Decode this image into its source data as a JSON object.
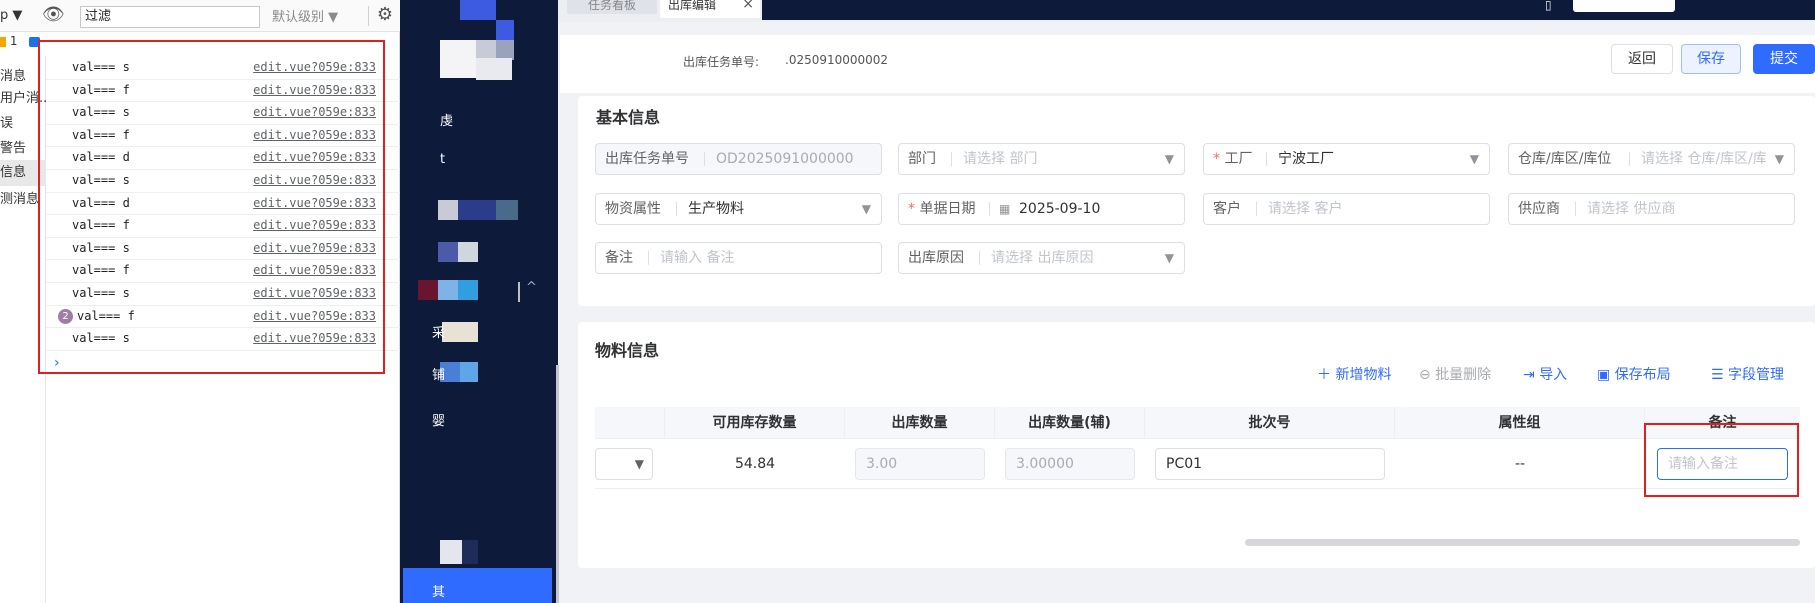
{
  "devtools": {
    "context": "p ▼",
    "filter_value": "过滤",
    "level_label": "默认级别 ▼",
    "counts": {
      "warnings": "1"
    },
    "sidebar": [
      {
        "label": "消息"
      },
      {
        "label": "用户消..."
      },
      {
        "label": "误"
      },
      {
        "label": "警告"
      },
      {
        "label": "信息",
        "active": true
      },
      {
        "label": "测消息"
      }
    ],
    "logs": [
      {
        "msg": "val=== s",
        "src": "edit.vue?059e:833"
      },
      {
        "msg": "val=== f",
        "src": "edit.vue?059e:833"
      },
      {
        "msg": "val=== s",
        "src": "edit.vue?059e:833"
      },
      {
        "msg": "val=== f",
        "src": "edit.vue?059e:833"
      },
      {
        "msg": "val=== d",
        "src": "edit.vue?059e:833"
      },
      {
        "msg": "val=== s",
        "src": "edit.vue?059e:833"
      },
      {
        "msg": "val=== d",
        "src": "edit.vue?059e:833"
      },
      {
        "msg": "val=== f",
        "src": "edit.vue?059e:833"
      },
      {
        "msg": "val=== s",
        "src": "edit.vue?059e:833"
      },
      {
        "msg": "val=== f",
        "src": "edit.vue?059e:833"
      },
      {
        "msg": "val=== s",
        "src": "edit.vue?059e:833"
      },
      {
        "msg": "val=== f",
        "src": "edit.vue?059e:833",
        "count": "2"
      },
      {
        "msg": "val=== s",
        "src": "edit.vue?059e:833"
      }
    ],
    "prompt": "›"
  },
  "nav": {
    "labels": [
      "虔",
      "t",
      "采",
      "铺",
      "婴",
      "其"
    ],
    "collapse_icon": "^"
  },
  "tabs": {
    "inactive_label": "任务看板",
    "active_label": "出库编辑",
    "close": "×"
  },
  "header": {
    "task_no_label": "出库任务单号:",
    "task_no_value": ".0250910000002",
    "back": "返回",
    "save": "保存",
    "submit": "提交"
  },
  "basic": {
    "title": "基本信息",
    "fields": [
      {
        "label": "出库任务单号",
        "value": "OD20250910000002",
        "placeholder": false,
        "disabled": true,
        "required": false,
        "caret": false
      },
      {
        "label": "部门",
        "value": "请选择 部门",
        "placeholder": true,
        "disabled": false,
        "required": false,
        "caret": true
      },
      {
        "label": "工厂",
        "value": "宁波工厂",
        "placeholder": false,
        "disabled": false,
        "required": true,
        "caret": true
      },
      {
        "label": "仓库/库区/库位",
        "value": "请选择 仓库/库区/库",
        "placeholder": true,
        "disabled": false,
        "required": false,
        "caret": true
      },
      {
        "label": "物资属性",
        "value": "生产物料",
        "placeholder": false,
        "disabled": false,
        "required": false,
        "caret": true
      },
      {
        "label": "单据日期",
        "value": "2025-09-10",
        "placeholder": false,
        "disabled": false,
        "required": true,
        "caret": false,
        "icon": "calendar-icon"
      },
      {
        "label": "客户",
        "value": "请选择 客户",
        "placeholder": true,
        "disabled": false,
        "required": false,
        "caret": false
      },
      {
        "label": "供应商",
        "value": "请选择 供应商",
        "placeholder": true,
        "disabled": false,
        "required": false,
        "caret": false
      },
      {
        "label": "备注",
        "value": "请输入 备注",
        "placeholder": true,
        "disabled": false,
        "required": false,
        "caret": false
      },
      {
        "label": "出库原因",
        "value": "请选择 出库原因",
        "placeholder": true,
        "disabled": false,
        "required": false,
        "caret": true
      }
    ]
  },
  "material": {
    "title": "物料信息",
    "toolbar": {
      "add": "新增物料",
      "batch_delete": "批量删除",
      "import": "导入",
      "save_layout": "保存布局",
      "field_manage": "字段管理"
    },
    "columns": [
      "可用库存数量",
      "出库数量",
      "出库数量(辅)",
      "批次号",
      "属性组",
      "备注"
    ],
    "row": {
      "available": "54.84",
      "qty": "3.00",
      "qty_aux": "3.00000",
      "batch": "PC01",
      "attr_group": "--",
      "remark_placeholder": "请输入备注"
    }
  },
  "colors": {
    "primary": "#2f6bff",
    "nav_bg": "#0d1a3a",
    "highlight_box": "#e02020"
  }
}
